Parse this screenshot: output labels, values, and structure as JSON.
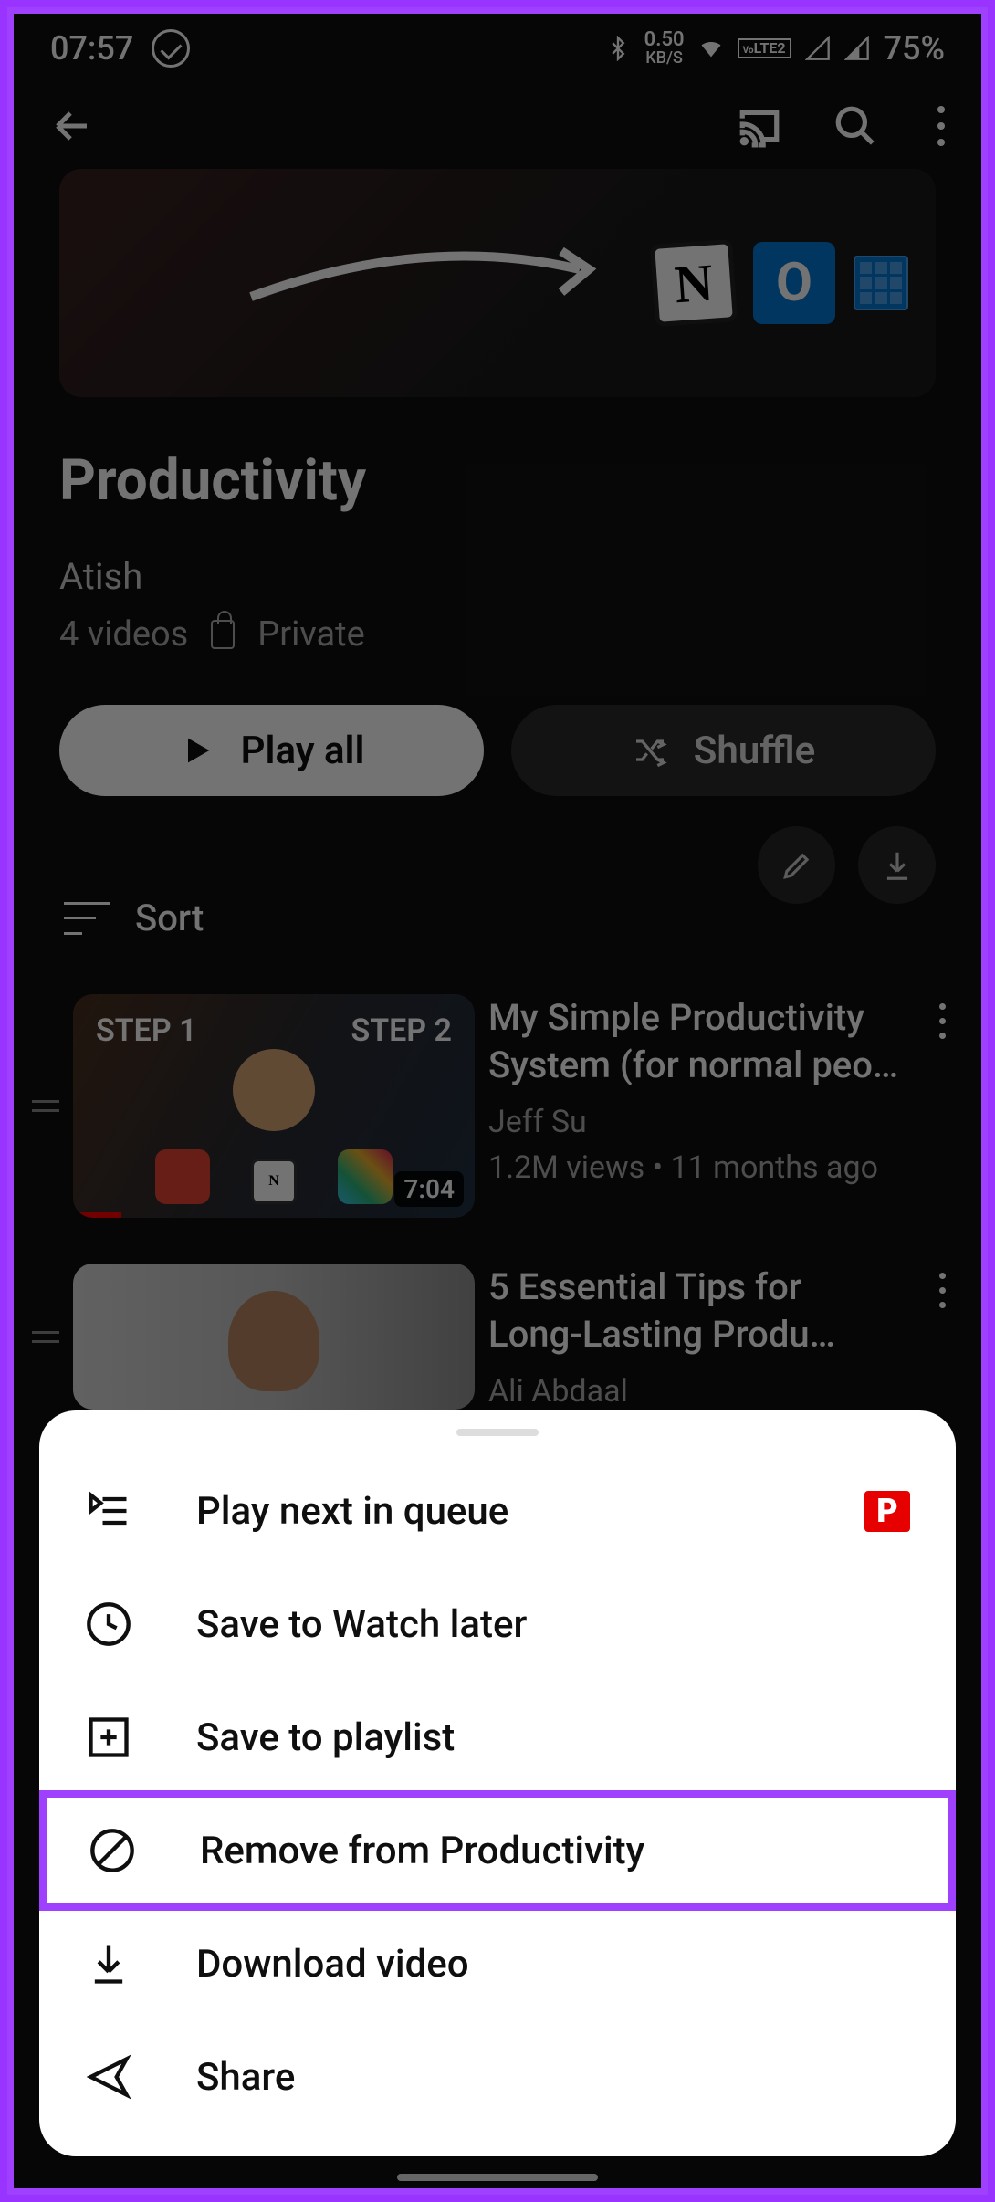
{
  "status": {
    "time": "07:57",
    "net_speed": "0.50",
    "net_unit": "KB/S",
    "battery": "75%",
    "lte": "LTE",
    "lte_sim": "2",
    "volte": "Vo"
  },
  "playlist": {
    "title": "Productivity",
    "author": "Atish",
    "count": "4 videos",
    "privacy": "Private"
  },
  "buttons": {
    "play_all": "Play all",
    "shuffle": "Shuffle"
  },
  "sort": {
    "label": "Sort"
  },
  "videos": [
    {
      "step1": "STEP 1",
      "step2": "STEP 2",
      "title": "My Simple Productivity System (for normal peo…",
      "channel": "Jeff Su",
      "views": "1.2M views",
      "age": "11 months ago",
      "duration": "7:04"
    },
    {
      "title": "5 Essential Tips for Long-Lasting Produ…",
      "channel": "Ali Abdaal"
    }
  ],
  "sheet": {
    "play_next": "Play next in queue",
    "watch_later": "Save to Watch later",
    "save_playlist": "Save to playlist",
    "remove": "Remove from Productivity",
    "download": "Download video",
    "share": "Share",
    "p_badge": "P"
  }
}
